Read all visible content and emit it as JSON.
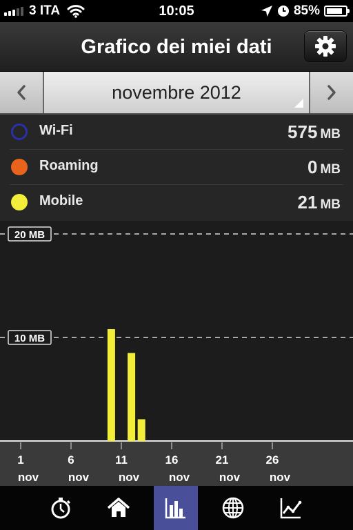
{
  "status_bar": {
    "carrier": "3 ITA",
    "time": "10:05",
    "battery_percent": "85%",
    "battery_level": 0.85,
    "icons": [
      "signal-icon",
      "wifi-icon",
      "location-arrow-icon",
      "clock-icon",
      "battery-icon"
    ]
  },
  "nav": {
    "title": "Grafico dei miei dati",
    "settings_icon": "gear-icon"
  },
  "month_selector": {
    "month": "novembre 2012",
    "prev_icon": "chevron-left-icon",
    "next_icon": "chevron-right-icon"
  },
  "legend": [
    {
      "name": "Wi-Fi",
      "value": "575",
      "unit": "MB",
      "color": "#2b2fa8",
      "style": "ring"
    },
    {
      "name": "Roaming",
      "value": "0",
      "unit": "MB",
      "color": "#e8641c",
      "style": "filled"
    },
    {
      "name": "Mobile",
      "value": "21",
      "unit": "MB",
      "color": "#f3ee3a",
      "style": "filled"
    }
  ],
  "chart_data": {
    "type": "bar",
    "y_unit": "MB",
    "ylim": [
      0,
      20
    ],
    "gridlines": [
      {
        "value": 20,
        "label": "20 MB"
      },
      {
        "value": 10,
        "label": "10 MB"
      }
    ],
    "x_range": [
      1,
      30
    ],
    "x_ticks": [
      {
        "day": 1,
        "label": "1",
        "sub": "nov"
      },
      {
        "day": 6,
        "label": "6",
        "sub": "nov"
      },
      {
        "day": 11,
        "label": "11",
        "sub": "nov"
      },
      {
        "day": 16,
        "label": "16",
        "sub": "nov"
      },
      {
        "day": 21,
        "label": "21",
        "sub": "nov"
      },
      {
        "day": 26,
        "label": "26",
        "sub": "nov"
      }
    ],
    "series": [
      {
        "name": "Mobile",
        "color": "#f3ee3a",
        "points": [
          {
            "day": 10,
            "value": 10.8
          },
          {
            "day": 12,
            "value": 8.5
          },
          {
            "day": 13,
            "value": 2.1
          }
        ]
      }
    ],
    "grid": true
  },
  "tabs": [
    {
      "icon": "stopwatch-icon",
      "active": false
    },
    {
      "icon": "home-icon",
      "active": false
    },
    {
      "icon": "bar-chart-icon",
      "active": true
    },
    {
      "icon": "globe-icon",
      "active": false
    },
    {
      "icon": "line-chart-icon",
      "active": false
    }
  ]
}
